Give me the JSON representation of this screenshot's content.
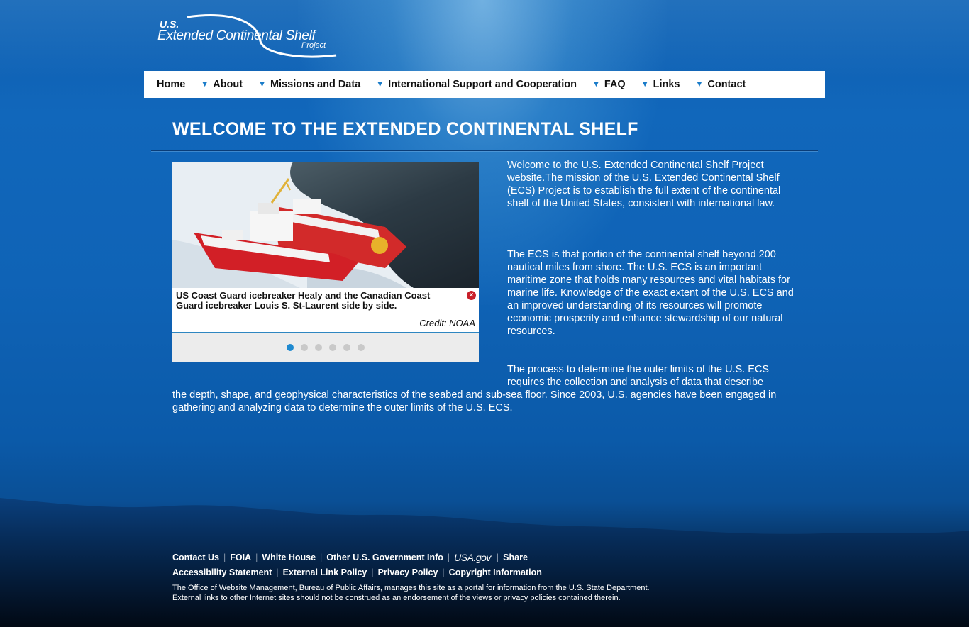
{
  "logo": {
    "line1": "U.S.",
    "line2": "Extended Continental Shelf",
    "line3": "Project"
  },
  "nav": {
    "items": [
      {
        "label": "Home",
        "dropdown": false
      },
      {
        "label": "About",
        "dropdown": true
      },
      {
        "label": "Missions and Data",
        "dropdown": true
      },
      {
        "label": "International Support and Cooperation",
        "dropdown": true
      },
      {
        "label": "FAQ",
        "dropdown": true
      },
      {
        "label": "Links",
        "dropdown": true
      },
      {
        "label": "Contact",
        "dropdown": true
      }
    ],
    "caret_icon": "triangle-down-icon"
  },
  "page_title": "WELCOME TO THE EXTENDED CONTINENTAL SHELF",
  "slideshow": {
    "caption": "US Coast Guard icebreaker Healy and the Canadian Coast Guard icebreaker Louis S. St-Laurent side by side.",
    "credit": "Credit: NOAA",
    "slide_count": 6,
    "active_slide": 1,
    "close_icon": "close-icon"
  },
  "content": {
    "p1": "Welcome to the U.S. Extended Continental Shelf Project website.The mission of the U.S. Extended Continental Shelf (ECS) Project is to establish the full extent of the continental shelf of the United States, consistent with international law.",
    "p2": "The ECS is that portion of the continental shelf beyond 200 nautical miles from shore.  The U.S. ECS is an important maritime zone that holds many resources and vital habitats for marine life.  Knowledge of the exact extent of the U.S. ECS and an improved understanding of its resources will promote economic prosperity and enhance stewardship of our natural resources.",
    "p3a": "The process to determine the outer limits of the U.S. ECS requires the collection and analysis of data that describe",
    "p3b": "the depth, shape, and geophysical characteristics of the seabed and sub-sea floor.  Since 2003, U.S. agencies have been engaged in gathering and analyzing data to determine the outer limits of the U.S. ECS."
  },
  "footer": {
    "row1": [
      "Contact Us",
      "FOIA",
      "White House",
      "Other U.S. Government Info"
    ],
    "usa_logo": "USA.gov",
    "share": "Share",
    "row2": [
      "Accessibility Statement",
      "External Link Policy",
      "Privacy Policy",
      "Copyright Information"
    ],
    "note_line1": "The Office of Website Management, Bureau of Public Affairs, manages this site as a portal for information from the U.S. State Department.",
    "note_line2": "External links to other Internet sites should not be construed as an endorsement of the views or privacy policies contained therein."
  },
  "colors": {
    "nav_caret": "#1a7cc9",
    "active_dot": "#1f8ad0",
    "close_red": "#c8202a",
    "ocean": "#1167bb"
  }
}
